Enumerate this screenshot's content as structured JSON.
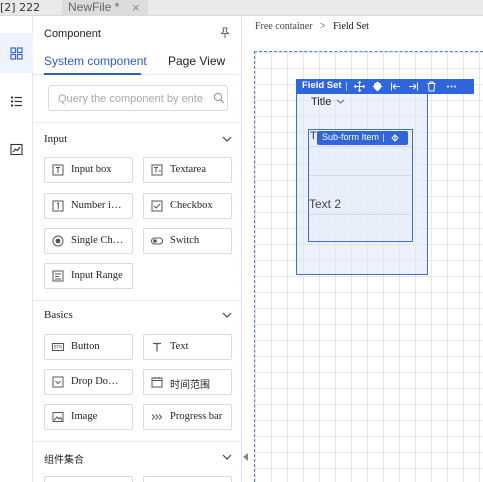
{
  "tabs": [
    {
      "label": "[2] 222"
    },
    {
      "label": "NewFile *",
      "close": "×"
    }
  ],
  "rail": [
    {
      "icon": "grid-icon",
      "active": true
    },
    {
      "icon": "list-tree-icon",
      "active": false
    },
    {
      "icon": "chart-icon",
      "active": false
    }
  ],
  "panel": {
    "title": "Component",
    "tabs": [
      "System component",
      "Page View"
    ],
    "search_placeholder": "Query the component by ente",
    "sections": [
      {
        "name": "Input",
        "items": [
          {
            "label": "Input box",
            "icon": "input-box-icon"
          },
          {
            "label": "Textarea",
            "icon": "textarea-icon"
          },
          {
            "label": "Number i…",
            "icon": "number-input-icon"
          },
          {
            "label": "Checkbox",
            "icon": "checkbox-icon"
          },
          {
            "label": "Single Ch…",
            "icon": "radio-icon"
          },
          {
            "label": "Switch",
            "icon": "switch-icon"
          },
          {
            "label": "Input Range",
            "icon": "input-range-icon"
          }
        ]
      },
      {
        "name": "Basics",
        "items": [
          {
            "label": "Button",
            "icon": "button-icon"
          },
          {
            "label": "Text",
            "icon": "text-icon"
          },
          {
            "label": "Drop Do…",
            "icon": "dropdown-icon"
          },
          {
            "label": "时间范围",
            "icon": "calendar-icon"
          },
          {
            "label": "Image",
            "icon": "image-icon"
          },
          {
            "label": "Progress bar",
            "icon": "progress-icon"
          }
        ]
      },
      {
        "name": "组件集合",
        "items": []
      }
    ]
  },
  "canvas": {
    "breadcrumb": [
      "Free container",
      ">",
      "Field Set"
    ],
    "fieldset": {
      "toolbar_label": "Field Set",
      "title": "Title",
      "sub_form_label": "Sub-form Item",
      "t_char": "T",
      "text2": "Text 2"
    }
  },
  "colors": {
    "accent": "#2f66dc",
    "tab_active_text": "#2a5bd7"
  }
}
